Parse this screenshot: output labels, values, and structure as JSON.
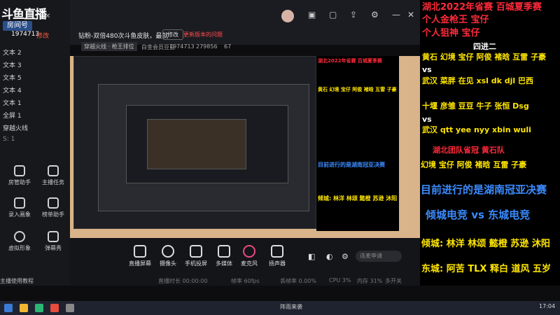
{
  "app": {
    "logo": "斗鱼直播",
    "room_badge": "房间号",
    "room_id": "1974713",
    "room_tag": "修改",
    "scenes": [
      "文本 2",
      "文本 3",
      "文本 5",
      "文本 4",
      "文本 1",
      "全屏 1",
      "穿越火线"
    ],
    "scene_count": "S: 1",
    "grid_items": [
      "房管助手",
      "主播任务",
      "录入画象",
      "榜单助手",
      "虚拟形象",
      "弹幕秀"
    ],
    "help": "主播使用教程"
  },
  "toolbar": {
    "title": "钻粉-双倍480次斗鱼皮肤，最就",
    "edit_label": "修改",
    "warning": "更新版本的问题",
    "category": "穿越火线 · 枪王排位",
    "notice": "白金会员豆豆",
    "room_id": "1974713",
    "hot": "279856",
    "fans": "67"
  },
  "overlay": {
    "title": "湖北2022年省赛 百城夏季赛",
    "line2": "个人金枪王 宝仔",
    "line3": "个人狙神 宝仔",
    "round": "四进二",
    "team1": "黄石 幻境 宝仔 阿俊 褚晗 互雷 子豪",
    "vs1": "vs",
    "team2": "武汉 菜胖 在见 xsl dk djl 巴西",
    "team3": "十堰 彦雏 豆豆 牛子 张恒 Dsg",
    "vs2": "vs",
    "team4": "武汉 qtt yee nyy xbin wuli",
    "champion_title": "湖北团队省冠 黄石队",
    "champion_players": "幻境 宝仔 阿俊 褚晗 互雷 子豪",
    "current": "目前进行的是湖南冠亚决赛",
    "match": "倾城电竞 vs 东城电竞",
    "roster1": "倾城: 林洋 林颂 懿橙 苏逊 沐阳",
    "roster2": "东城: 阿苦 TLX 释白 道风 五岁"
  },
  "bottom": {
    "items": [
      "直播屏幕",
      "摄像头",
      "手机投屏",
      "多媒体",
      "麦克风",
      "扬声器"
    ],
    "search_placeholder": "连麦申请",
    "status": [
      "直播时长 00:00:00",
      "帧率 60fps",
      "丢帧率 0.00%",
      "CPU 3%",
      "内存 31%",
      "多开关"
    ]
  },
  "taskbar": {
    "weather": "阵雨来袭",
    "time": "17:04"
  },
  "colors": {
    "overlay_red": "#ff2a3a",
    "overlay_yellow": "#ffe600",
    "overlay_blue": "#3a8bff"
  }
}
